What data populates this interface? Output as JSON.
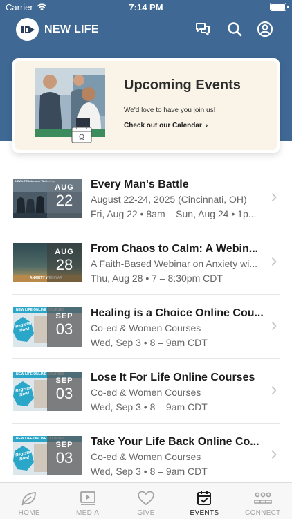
{
  "status_bar": {
    "carrier": "Carrier",
    "time": "7:14 PM"
  },
  "app_bar": {
    "title": "NEW LIFE"
  },
  "hero": {
    "title": "Upcoming Events",
    "subtitle": "We'd love to have you join us!",
    "link_label": "Check out our Calendar",
    "chevron": "›"
  },
  "events": [
    {
      "title": "Every Man's Battle",
      "subtitle": "August 22-24, 2025 (Cincinnati, OH)",
      "time": "Fri, Aug 22 • 8am – Sun, Aug 24 • 1p...",
      "month": "AUG",
      "day": "22",
      "thumb_caption": "NEWLIFE Intensive Workshop"
    },
    {
      "title": "From Chaos to Calm: A Webin...",
      "subtitle": "A Faith-Based Webinar on Anxiety wi...",
      "time": "Thu, Aug 28 • 7 – 8:30pm CDT",
      "month": "AUG",
      "day": "28",
      "thumb_caption": "ANXIETY WEBINAR"
    },
    {
      "title": "Healing is a Choice Online Cou...",
      "subtitle": "Co-ed & Women Courses",
      "time": "Wed, Sep 3 • 8 – 9am CDT",
      "month": "SEP",
      "day": "03",
      "thumb_caption": "NEW LIFE ONLINE COURSES",
      "badge": "Register Now!"
    },
    {
      "title": "Lose It For Life Online Courses",
      "subtitle": "Co-ed & Women Courses",
      "time": "Wed, Sep 3 • 8 – 9am CDT",
      "month": "SEP",
      "day": "03",
      "thumb_caption": "NEW LIFE ONLINE COURSES",
      "badge": "Register Now!"
    },
    {
      "title": "Take Your Life Back Online Co...",
      "subtitle": "Co-ed & Women Courses",
      "time": "Wed, Sep 3 • 8 – 9am CDT",
      "month": "SEP",
      "day": "03",
      "thumb_caption": "NEW LIFE ONLINE COURSES",
      "badge": "Register Now!"
    }
  ],
  "tabs": [
    {
      "label": "HOME",
      "icon": "leaf-icon",
      "active": false
    },
    {
      "label": "MEDIA",
      "icon": "play-video-icon",
      "active": false
    },
    {
      "label": "GIVE",
      "icon": "heart-icon",
      "active": false
    },
    {
      "label": "EVENTS",
      "icon": "calendar-check-icon",
      "active": true
    },
    {
      "label": "CONNECT",
      "icon": "people-group-icon",
      "active": false
    }
  ],
  "colors": {
    "header_blue": "#3f6994",
    "hero_bg": "#faf4e8",
    "badge_teal": "#2aa6c9"
  }
}
